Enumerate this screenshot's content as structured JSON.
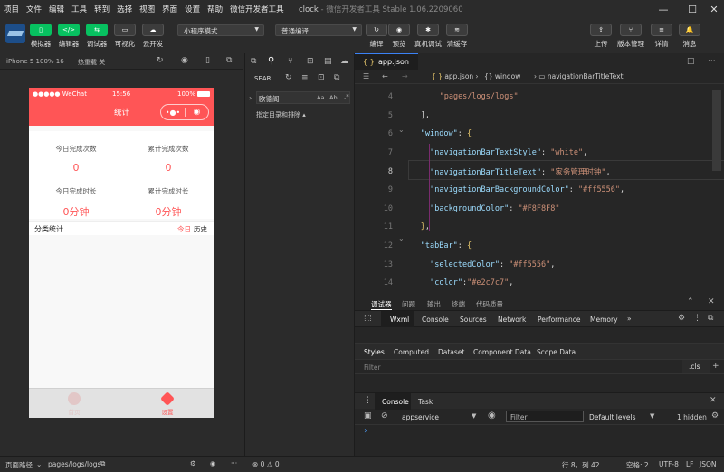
{
  "menu": [
    "项目",
    "文件",
    "编辑",
    "工具",
    "转到",
    "选择",
    "视图",
    "界面",
    "设置",
    "帮助",
    "微信开发者工具"
  ],
  "window": {
    "title": "clock",
    "subtitle": " - 微信开发者工具 Stable 1.06.2209060"
  },
  "toolbar": {
    "left": [
      {
        "label": "模拟器",
        "icon": "phone-icon"
      },
      {
        "label": "编辑器",
        "icon": "code-icon"
      },
      {
        "label": "调试器",
        "icon": "debug-icon"
      },
      {
        "label": "可视化",
        "icon": "visual-icon"
      },
      {
        "label": "云开发",
        "icon": "cloud-icon"
      }
    ],
    "mode_select": "小程序模式",
    "compile_select": "普通编译",
    "right_mid": [
      {
        "label": "编译",
        "icon": "refresh-icon"
      },
      {
        "label": "预览",
        "icon": "eye-icon"
      },
      {
        "label": "真机调试",
        "icon": "bug-icon"
      },
      {
        "label": "清缓存",
        "icon": "layers-icon"
      }
    ],
    "right": [
      {
        "label": "上传",
        "icon": "upload-icon"
      },
      {
        "label": "版本管理",
        "icon": "branch-icon"
      },
      {
        "label": "详情",
        "icon": "menu-icon"
      },
      {
        "label": "消息",
        "icon": "bell-icon"
      }
    ]
  },
  "simulator": {
    "device": "iPhone 5 100% 16",
    "hot_reload": "热重载 关"
  },
  "phone": {
    "carrier": "●●●●● WeChat",
    "time": "15:56",
    "battery": "100%",
    "nav_title": "统计",
    "stats": [
      {
        "label": "今日完成次数",
        "value": "0"
      },
      {
        "label": "累计完成次数",
        "value": "0"
      },
      {
        "label": "今日完成时长",
        "value": "0分钟"
      },
      {
        "label": "累计完成时长",
        "value": "0分钟"
      }
    ],
    "category_label": "分类统计",
    "category_today": "今日",
    "category_history": "历史",
    "tabs": [
      {
        "label": "首页"
      },
      {
        "label": "设置"
      }
    ]
  },
  "explorer": {
    "search": "SEAR...",
    "folder": "欧德阁",
    "filter": "指定目录和排除",
    "aa": "Aa",
    "ab": "Ab|"
  },
  "editor": {
    "tab": "app.json",
    "breadcrumb": [
      "app.json",
      "{} window",
      "navigationBarTitleText"
    ],
    "lines": [
      {
        "n": "4",
        "parts": [
          [
            "s",
            "\"pages/logs/logs\""
          ]
        ],
        "indent": "        "
      },
      {
        "n": "5",
        "parts": [
          [
            "p",
            "],"
          ]
        ],
        "indent": "    "
      },
      {
        "n": "6",
        "parts": [
          [
            "k",
            "\"window\""
          ],
          [
            "p",
            ": "
          ],
          [
            "y",
            "{"
          ]
        ],
        "indent": "    "
      },
      {
        "n": "7",
        "parts": [
          [
            "k",
            "\"navigationBarTextStyle\""
          ],
          [
            "p",
            ": "
          ],
          [
            "s",
            "\"white\""
          ],
          [
            "p",
            ","
          ]
        ],
        "indent": "      "
      },
      {
        "n": "8",
        "parts": [
          [
            "k",
            "\"navigationBarTitleText\""
          ],
          [
            "p",
            ": "
          ],
          [
            "s",
            "\"家务管理时钟\""
          ],
          [
            "p",
            ","
          ]
        ],
        "indent": "      "
      },
      {
        "n": "9",
        "parts": [
          [
            "k",
            "\"navigationBarBackgroundColor\""
          ],
          [
            "p",
            ": "
          ],
          [
            "s",
            "\"#ff5556\""
          ],
          [
            "p",
            ","
          ]
        ],
        "indent": "      "
      },
      {
        "n": "10",
        "parts": [
          [
            "k",
            "\"backgroundColor\""
          ],
          [
            "p",
            ": "
          ],
          [
            "s",
            "\"#F8F8F8\""
          ]
        ],
        "indent": "      "
      },
      {
        "n": "11",
        "parts": [
          [
            "y",
            "}"
          ],
          [
            "p",
            ","
          ]
        ],
        "indent": "    "
      },
      {
        "n": "12",
        "parts": [
          [
            "k",
            "\"tabBar\""
          ],
          [
            "p",
            ": "
          ],
          [
            "y",
            "{"
          ]
        ],
        "indent": "    "
      },
      {
        "n": "13",
        "parts": [
          [
            "k",
            "\"selectedColor\""
          ],
          [
            "p",
            ": "
          ],
          [
            "s",
            "\"#ff5556\""
          ],
          [
            "p",
            ","
          ]
        ],
        "indent": "      "
      },
      {
        "n": "14",
        "parts": [
          [
            "k",
            "\"color\""
          ],
          [
            "p",
            ":"
          ],
          [
            "s",
            "\"#e2c7c7\""
          ],
          [
            "p",
            ","
          ]
        ],
        "indent": "      "
      }
    ]
  },
  "devtools": {
    "top_tabs": [
      "调试器",
      "问题",
      "输出",
      "终端",
      "代码质量"
    ],
    "tabs": [
      "Wxml",
      "Console",
      "Sources",
      "Network",
      "Performance",
      "Memory"
    ],
    "style_tabs": [
      "Styles",
      "Computed",
      "Dataset",
      "Component Data",
      "Scope Data"
    ],
    "filter": "Filter",
    "cls": ".cls",
    "console_tabs": [
      "Console",
      "Task"
    ],
    "context": "appservice",
    "console_filter": "Filter",
    "levels": "Default levels",
    "hidden": "1 hidden",
    "prompt": "›"
  },
  "status": {
    "path_label": "页面路径",
    "path": "pages/logs/logs",
    "errors": "⊗ 0 ⚠ 0",
    "pos": "行 8，列 42",
    "spaces": "空格: 2",
    "enc": "UTF-8",
    "eol": "LF",
    "lang": "JSON"
  }
}
